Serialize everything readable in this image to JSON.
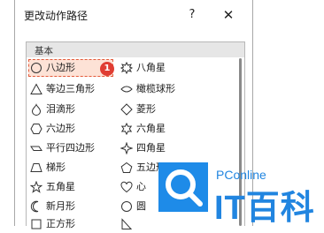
{
  "dialog": {
    "title": "更改动作路径",
    "help_label": "?",
    "close_label": "✕"
  },
  "section": {
    "label": "基本"
  },
  "items": [
    {
      "label": "八边形",
      "icon": "octagon-icon",
      "selected": true
    },
    {
      "label": "八角星",
      "icon": "eight-point-star-icon"
    },
    {
      "label": "等边三角形",
      "icon": "triangle-icon"
    },
    {
      "label": "橄榄球形",
      "icon": "football-icon"
    },
    {
      "label": "泪滴形",
      "icon": "teardrop-icon"
    },
    {
      "label": "菱形",
      "icon": "diamond-icon"
    },
    {
      "label": "六边形",
      "icon": "hexagon-icon"
    },
    {
      "label": "六角星",
      "icon": "six-point-star-icon"
    },
    {
      "label": "平行四边形",
      "icon": "parallelogram-icon"
    },
    {
      "label": "四角星",
      "icon": "four-point-star-icon"
    },
    {
      "label": "梯形",
      "icon": "trapezoid-icon"
    },
    {
      "label": "五边形",
      "icon": "pentagon-icon"
    },
    {
      "label": "五角星",
      "icon": "five-point-star-icon"
    },
    {
      "label": "心",
      "icon": "heart-icon"
    },
    {
      "label": "新月形",
      "icon": "crescent-icon"
    },
    {
      "label": "圆",
      "icon": "circle-icon"
    },
    {
      "label": "正方形",
      "icon": "square-icon"
    },
    {
      "label": "",
      "icon": "right-triangle-icon"
    }
  ],
  "annotation": {
    "badge": "1",
    "color": "#e03d32"
  },
  "watermark": {
    "brand": "PConline",
    "name": "IT百科",
    "color": "#2185e0"
  }
}
